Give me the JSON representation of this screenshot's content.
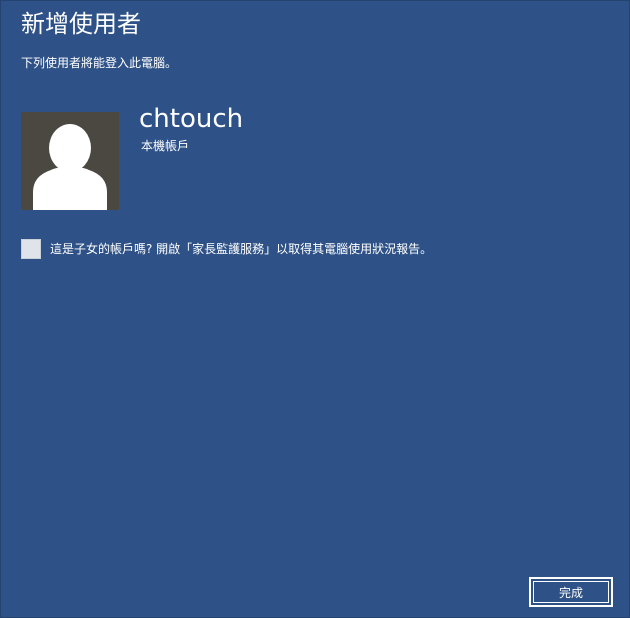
{
  "dialog": {
    "title": "新增使用者",
    "subtitle": "下列使用者將能登入此電腦。"
  },
  "user": {
    "name": "chtouch",
    "account_type": "本機帳戶",
    "avatar_icon": "default-user-silhouette-icon"
  },
  "family_safety": {
    "checked": false,
    "label": "這是子女的帳戶嗎? 開啟「家長監護服務」以取得其電腦使用狀況報告。"
  },
  "actions": {
    "done_label": "完成"
  },
  "colors": {
    "background": "#2e5287",
    "avatar_background": "#4b4741",
    "text": "#ffffff",
    "checkbox": "#dfe4ea"
  }
}
